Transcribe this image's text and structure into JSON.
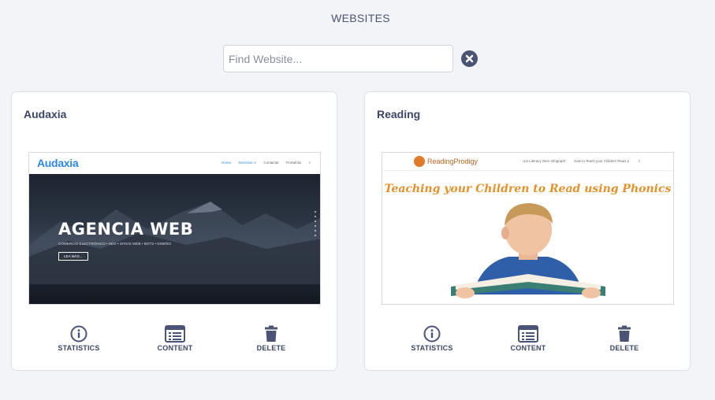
{
  "page": {
    "title": "WEBSITES"
  },
  "search": {
    "placeholder": "Find Website...",
    "value": "",
    "clear_icon": "close-circle-icon"
  },
  "colors": {
    "accent": "#4a5474",
    "text": "#3b4566",
    "background": "#f3f4f7"
  },
  "websites": [
    {
      "title": "Audaxia",
      "thumbnail": {
        "logo": "Audaxia",
        "menu": [
          "Home",
          "Servicios ∨",
          "Contactar",
          "Portafolio",
          "⌕"
        ],
        "headline": "AGENCIA WEB",
        "subline": "COMERCIO ELECTRÓNICO • SEO • SITIOS WEB • BOTS • DISEÑO",
        "button": "LEA MÁS..."
      },
      "actions": [
        {
          "label": "STATISTICS",
          "icon": "info-circle-icon"
        },
        {
          "label": "CONTENT",
          "icon": "list-icon"
        },
        {
          "label": "DELETE",
          "icon": "trash-icon"
        }
      ]
    },
    {
      "title": "Reading",
      "thumbnail": {
        "logo": "ReadingProdigy",
        "menu": [
          "ILS Literacy Over Infograph",
          "How to Teach your Children Read ∨",
          "⌕"
        ],
        "headline": "Teaching your Children to Read using Phonics"
      },
      "actions": [
        {
          "label": "STATISTICS",
          "icon": "info-circle-icon"
        },
        {
          "label": "CONTENT",
          "icon": "list-icon"
        },
        {
          "label": "DELETE",
          "icon": "trash-icon"
        }
      ]
    }
  ]
}
